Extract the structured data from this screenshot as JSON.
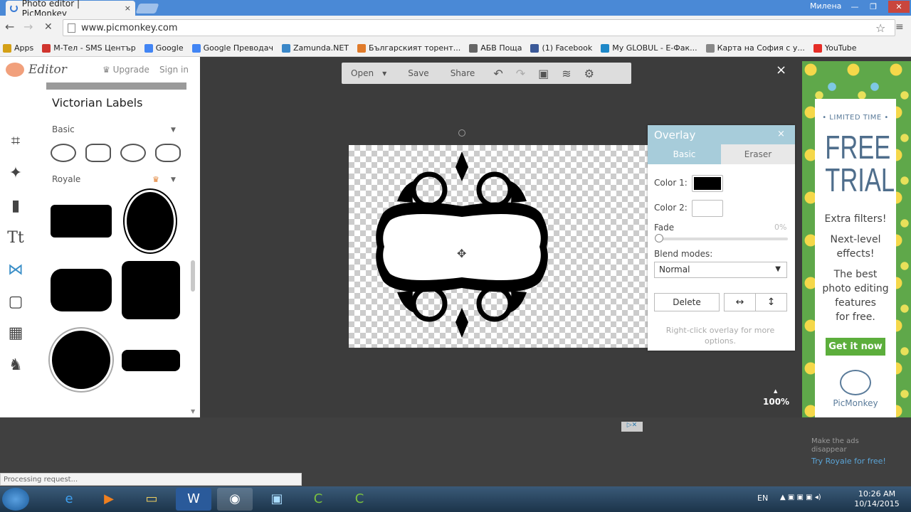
{
  "browser": {
    "tab_title": "Photo editor | PicMonkey",
    "tab_close": "×",
    "user": "Милена",
    "url": "www.picmonkey.com",
    "back": "←",
    "forward": "→",
    "stop": "✕",
    "star": "☆",
    "menu": "≡",
    "min": "—",
    "restore": "❐",
    "close": "✕",
    "bookmarks": [
      {
        "label": "Apps",
        "color": "#d4a017"
      },
      {
        "label": "М-Тел - SMS Център",
        "color": "#d0352e"
      },
      {
        "label": "Google",
        "color": "#4285f4"
      },
      {
        "label": "Google Преводач",
        "color": "#4285f4"
      },
      {
        "label": "Zamunda.NET",
        "color": "#3a87c8"
      },
      {
        "label": "Българският торент...",
        "color": "#e07b2a"
      },
      {
        "label": "АБВ Поща",
        "color": "#666666"
      },
      {
        "label": "(1) Facebook",
        "color": "#3b5998"
      },
      {
        "label": "My GLOBUL - Е-Фак...",
        "color": "#1e88c8"
      },
      {
        "label": "Карта на София с у...",
        "color": "#888888"
      },
      {
        "label": "YouTube",
        "color": "#e52d27"
      }
    ]
  },
  "editor": {
    "logo": "Editor",
    "upgrade": "Upgrade",
    "signin": "Sign in",
    "library_title": "Victorian Labels",
    "section_basic": "Basic",
    "section_royale": "Royale",
    "caret": "▼",
    "crown": "♛",
    "tools": [
      "crop-icon",
      "magic-wand-icon",
      "lipstick-icon",
      "text-icon",
      "butterfly-icon",
      "frame-icon",
      "texture-icon",
      "cat-icon"
    ],
    "toolbar": {
      "open": "Open",
      "open_caret": "▼",
      "save": "Save",
      "share": "Share",
      "undo": "↶",
      "redo": "↷",
      "image": "▣",
      "layers": "≋",
      "settings": "⚙"
    },
    "close": "×",
    "zoom": "100%",
    "zoom_caret": "▲"
  },
  "overlay_panel": {
    "title": "Overlay",
    "close": "×",
    "tab_basic": "Basic",
    "tab_eraser": "Eraser",
    "color1_label": "Color 1:",
    "color1": "#000000",
    "color2_label": "Color 2:",
    "color2": "#ffffff",
    "fade_label": "Fade",
    "fade_value": "0%",
    "blend_label": "Blend modes:",
    "blend_value": "Normal",
    "delete": "Delete",
    "flip_h": "↔",
    "flip_v": "↕",
    "hint": "Right-click overlay for more options."
  },
  "ad": {
    "limited": "• LIMITED TIME •",
    "free": "FREE",
    "trial": "TRIAL",
    "line1": "Extra filters!",
    "line2a": "Next-level",
    "line2b": "effects!",
    "line3a": "The best",
    "line3b": "photo editing",
    "line3c": "features",
    "line3d": "for free.",
    "cta": "Get it now",
    "brand": "PicMonkey",
    "badge": "▷✕",
    "make_ads_1": "Make the ads",
    "make_ads_2": "disappear",
    "try_royale": "Try Royale for free!"
  },
  "status": "Processing request...",
  "taskbar": {
    "lang": "EN",
    "time": "10:26 AM",
    "date": "10/14/2015"
  }
}
